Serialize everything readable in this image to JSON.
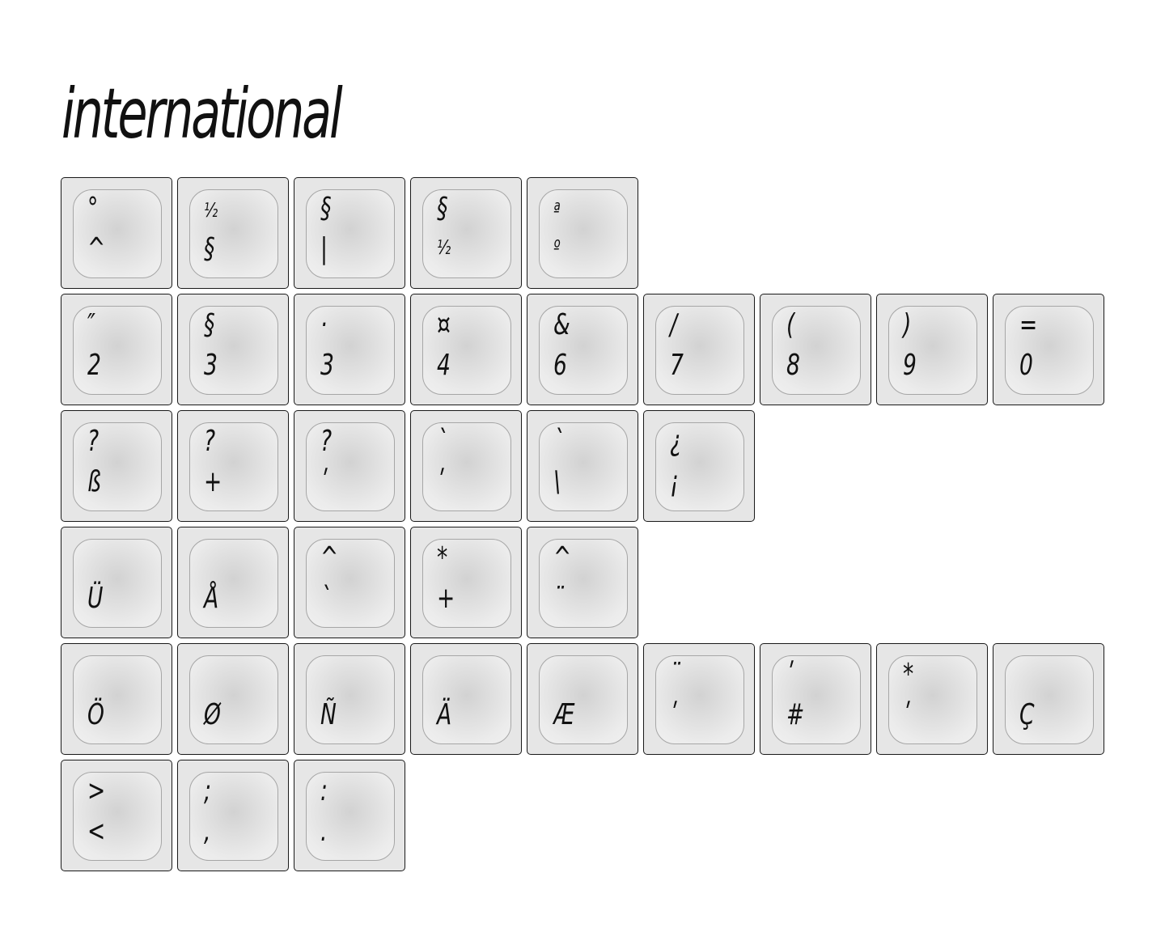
{
  "title": "international",
  "rows": [
    [
      "°|^",
      "½|§",
      "§||",
      "§|½",
      "ª|º"
    ],
    [
      "″|2",
      "§|3",
      "·|3",
      "¤|4",
      "&|6",
      "/|7",
      "(|8",
      ")|9",
      "=|0"
    ],
    [
      "?|ß",
      "?|+",
      "?|ʹ",
      "`|ʹ",
      "`|\\",
      "¿|¡"
    ],
    [
      "|Ü",
      "|Å",
      "^|`",
      "*|+",
      "^|¨"
    ],
    [
      "|Ö",
      "|Ø",
      "|Ñ",
      "|Ä",
      "|Æ",
      "¨|ʹ",
      "ʹ|#",
      "*|ʹ",
      "|Ç"
    ],
    [
      ">|<",
      ";|,",
      ":|."
    ]
  ]
}
